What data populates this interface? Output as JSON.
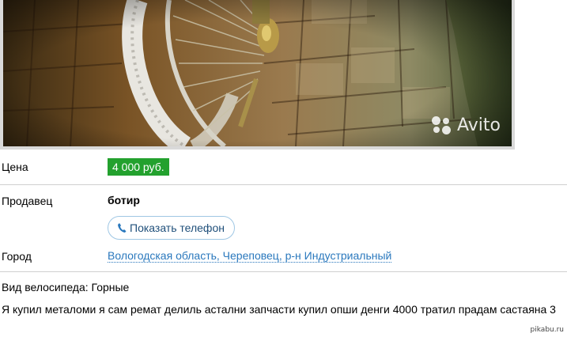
{
  "photo": {
    "watermark": "Avito"
  },
  "listing": {
    "price": {
      "label": "Цена",
      "value": "4 000 руб."
    },
    "seller": {
      "label": "Продавец",
      "name": "ботир",
      "phone_button": "Показать телефон"
    },
    "city": {
      "label": "Город",
      "value": "Вологодская область, Череповец, р-н Индустриальный"
    },
    "bike_type": "Вид велосипеда: Горные",
    "description": "Я купил металоми я сам ремат делиль астални запчасти купил опши денги 4000 тратил прадам састаяна 3"
  },
  "corner_watermark": "pikabu.ru",
  "colors": {
    "price_badge": "#23a12e",
    "link": "#2a78bd",
    "phone_button_border": "#9fc7e4",
    "divider": "#cfcfcf"
  },
  "icons": {
    "phone": "phone-icon",
    "avito_logo": "avito-dots-icon"
  }
}
